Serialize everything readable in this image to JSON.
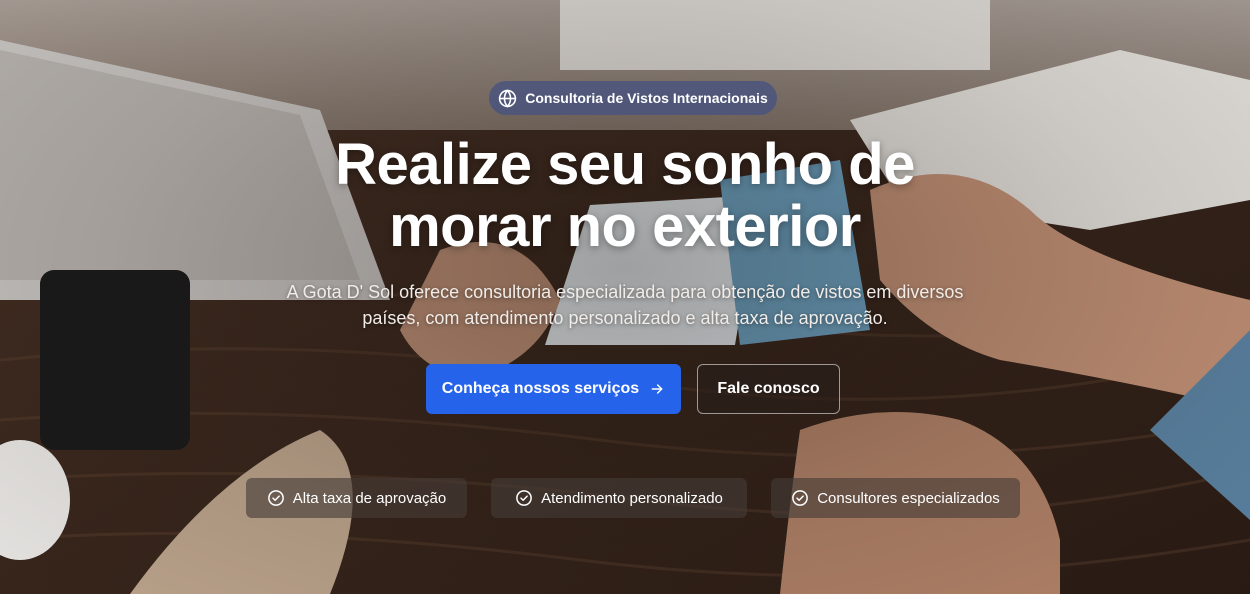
{
  "badge": {
    "icon": "globe-icon",
    "label": "Consultoria de Vistos Internacionais"
  },
  "hero": {
    "title_line1": "Realize seu sonho de",
    "title_line2": "morar no exterior",
    "subtitle_line1": "A Gota D' Sol oferece consultoria especializada para obtenção de vistos em diversos",
    "subtitle_line2": "países, com atendimento personalizado e alta taxa de aprovação."
  },
  "actions": {
    "primary_label": "Conheça nossos serviços",
    "primary_icon": "arrow-right-icon",
    "secondary_label": "Fale conosco"
  },
  "features": [
    {
      "label": "Alta taxa de aprovação",
      "icon": "check-circle-icon"
    },
    {
      "label": "Atendimento personalizado",
      "icon": "check-circle-icon"
    },
    {
      "label": "Consultores especializados",
      "icon": "check-circle-icon"
    }
  ],
  "colors": {
    "primary_button": "#2563eb",
    "badge_background": "#465280"
  }
}
